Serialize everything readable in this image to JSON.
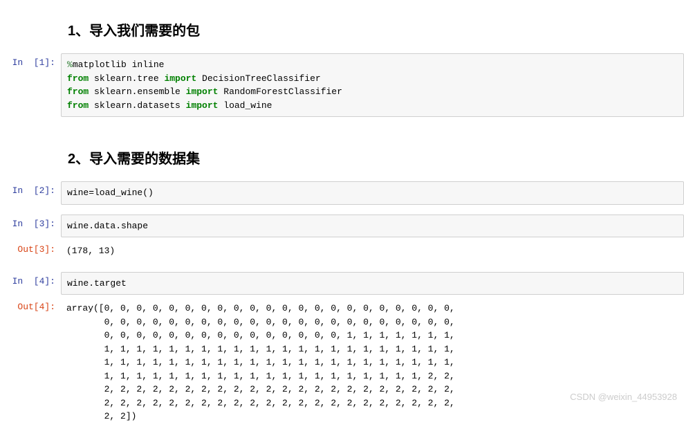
{
  "headings": {
    "h1": "1、导入我们需要的包",
    "h2": "2、导入需要的数据集"
  },
  "cells": {
    "c1": {
      "prompt": "In  [1]:",
      "code_tokens": [
        {
          "t": "%",
          "c": "k-magic"
        },
        {
          "t": "matplotlib inline\n"
        },
        {
          "t": "from",
          "c": "k-green"
        },
        {
          "t": " sklearn.tree "
        },
        {
          "t": "import",
          "c": "k-green"
        },
        {
          "t": " DecisionTreeClassifier\n"
        },
        {
          "t": "from",
          "c": "k-green"
        },
        {
          "t": " sklearn.ensemble "
        },
        {
          "t": "import",
          "c": "k-green"
        },
        {
          "t": " RandomForestClassifier\n"
        },
        {
          "t": "from",
          "c": "k-green"
        },
        {
          "t": " sklearn.datasets "
        },
        {
          "t": "import",
          "c": "k-green"
        },
        {
          "t": " load_wine"
        }
      ]
    },
    "c2": {
      "prompt": "In  [2]:",
      "code": "wine=load_wine()"
    },
    "c3": {
      "prompt": "In  [3]:",
      "code": "wine.data.shape"
    },
    "o3": {
      "prompt": "Out[3]:",
      "text": "(178, 13)"
    },
    "c4": {
      "prompt": "In  [4]:",
      "code": "wine.target"
    },
    "o4": {
      "prompt": "Out[4]:",
      "text": "array([0, 0, 0, 0, 0, 0, 0, 0, 0, 0, 0, 0, 0, 0, 0, 0, 0, 0, 0, 0, 0, 0,\n       0, 0, 0, 0, 0, 0, 0, 0, 0, 0, 0, 0, 0, 0, 0, 0, 0, 0, 0, 0, 0, 0,\n       0, 0, 0, 0, 0, 0, 0, 0, 0, 0, 0, 0, 0, 0, 0, 1, 1, 1, 1, 1, 1, 1,\n       1, 1, 1, 1, 1, 1, 1, 1, 1, 1, 1, 1, 1, 1, 1, 1, 1, 1, 1, 1, 1, 1,\n       1, 1, 1, 1, 1, 1, 1, 1, 1, 1, 1, 1, 1, 1, 1, 1, 1, 1, 1, 1, 1, 1,\n       1, 1, 1, 1, 1, 1, 1, 1, 1, 1, 1, 1, 1, 1, 1, 1, 1, 1, 1, 1, 2, 2,\n       2, 2, 2, 2, 2, 2, 2, 2, 2, 2, 2, 2, 2, 2, 2, 2, 2, 2, 2, 2, 2, 2,\n       2, 2, 2, 2, 2, 2, 2, 2, 2, 2, 2, 2, 2, 2, 2, 2, 2, 2, 2, 2, 2, 2,\n       2, 2])"
    }
  },
  "watermark": "CSDN @weixin_44953928"
}
